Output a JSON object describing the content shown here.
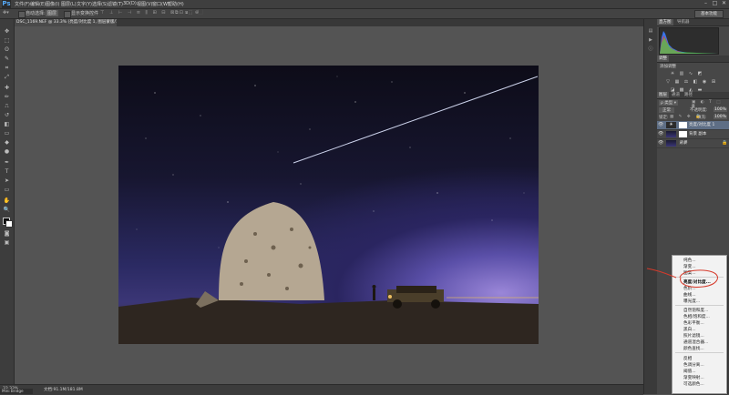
{
  "app": {
    "logo": "Ps"
  },
  "menubar": {
    "items": [
      "文件(F)",
      "编辑(E)",
      "图像(I)",
      "图层(L)",
      "文字(Y)",
      "选择(S)",
      "滤镜(T)",
      "3D(D)",
      "视图(V)",
      "窗口(W)",
      "帮助(H)"
    ],
    "window_buttons": [
      "–",
      "□",
      "✕"
    ]
  },
  "options": {
    "auto_select": "自动选择:",
    "layer_value": "图层",
    "show_transform": "显示变换控件",
    "workspace": "基本功能"
  },
  "document": {
    "tab_title": "DSC_1169.NEF @ 33.3% (亮度/对比度 1, 图层蒙版/16) * ×"
  },
  "status": {
    "zoom": "33.33%",
    "doc_size": "文档:91.1M/181.8M",
    "mini_bridge": "Mini Bridge"
  },
  "panels": {
    "histogram_tabs": [
      "直方图",
      "导航器"
    ],
    "adjustments_tab": "调整",
    "adjustments_title": "添加调整",
    "layers_tabs": [
      "图层",
      "通道",
      "路径"
    ],
    "blend_mode": "正常",
    "opacity_label": "不透明度:",
    "opacity_value": "100%",
    "lock_label": "锁定:",
    "fill_label": "填充:",
    "fill_value": "100%",
    "layers": [
      {
        "name": "亮度/对比度 1",
        "eye": "👁"
      },
      {
        "name": "背景 副本",
        "eye": "👁"
      },
      {
        "name": "背景",
        "eye": "👁"
      }
    ]
  },
  "adjustment_menu": {
    "items": [
      [
        "纯色...",
        "渐变...",
        "图案..."
      ],
      [
        "亮度/对比度...",
        "色阶...",
        "曲线...",
        "曝光度..."
      ],
      [
        "自然饱和度...",
        "色相/饱和度...",
        "色彩平衡...",
        "黑白...",
        "照片滤镜...",
        "通道混合器...",
        "颜色查找..."
      ],
      [
        "反相",
        "色调分离...",
        "阈值...",
        "渐变映射...",
        "可选颜色..."
      ]
    ],
    "highlighted": "亮度/对比度..."
  },
  "colors": {
    "accent": "#56a9f7",
    "annotation": "#d63a2b",
    "menu_bg": "#f2f2f2"
  }
}
